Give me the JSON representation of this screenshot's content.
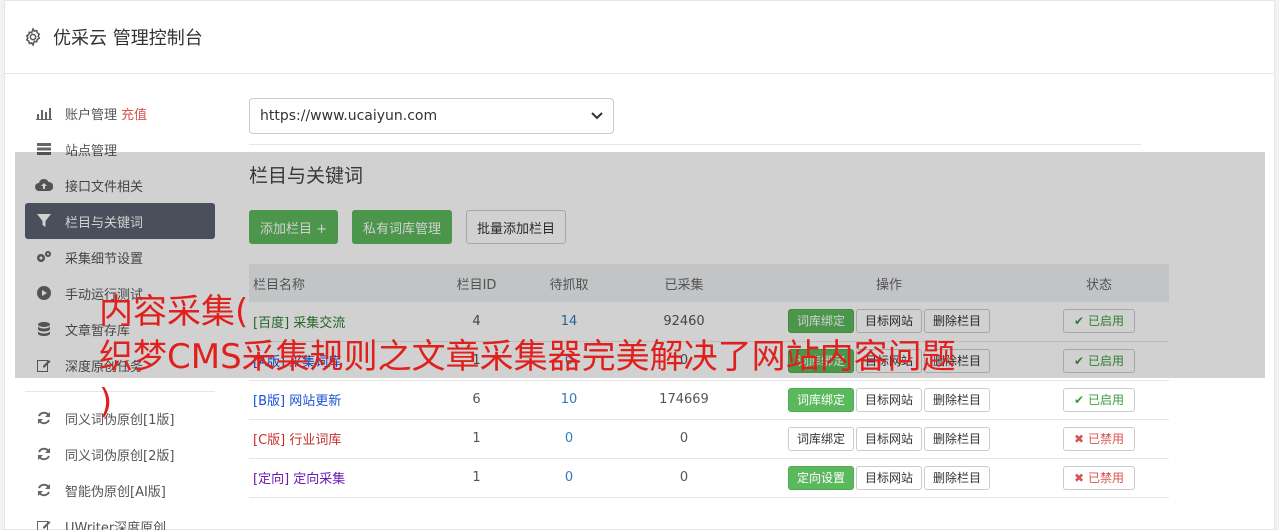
{
  "header": {
    "title": "优采云 管理控制台",
    "icon": "gear-icon"
  },
  "sidebar": {
    "items": [
      {
        "label": "账户管理",
        "extra": "充值",
        "icon": "bar-chart-icon",
        "active": false
      },
      {
        "label": "站点管理",
        "icon": "server-icon",
        "active": false
      },
      {
        "label": "接口文件相关",
        "icon": "cloud-upload-icon",
        "active": false
      },
      {
        "label": "栏目与关键词",
        "icon": "filter-icon",
        "active": true
      },
      {
        "label": "采集细节设置",
        "icon": "cogs-icon",
        "active": false
      },
      {
        "label": "手动运行测试",
        "icon": "play-circle-icon",
        "active": false
      },
      {
        "label": "文章暂存库",
        "icon": "database-icon",
        "active": false
      },
      {
        "label": "深度原创任务",
        "icon": "edit-icon",
        "active": false
      }
    ],
    "items2": [
      {
        "label": "同义词伪原创[1版]",
        "icon": "refresh-icon"
      },
      {
        "label": "同义词伪原创[2版]",
        "icon": "refresh-icon"
      },
      {
        "label": "智能伪原创[AI版]",
        "icon": "refresh-icon"
      },
      {
        "label": "UWriter深度原创",
        "icon": "edit-icon"
      }
    ]
  },
  "main": {
    "site_select": "https://www.ucaiyun.com",
    "section_title": "栏目与关键词",
    "buttons": {
      "add": "添加栏目 +",
      "private": "私有词库管理",
      "batch": "批量添加栏目"
    }
  },
  "table": {
    "headers": [
      "栏目名称",
      "栏目ID",
      "待抓取",
      "已采集",
      "操作",
      "状态"
    ],
    "rows": [
      {
        "tag": "[百度]",
        "name": "采集交流",
        "tag_color": "green",
        "id": "4",
        "pending": "14",
        "collected": "92460",
        "op1": "词库绑定",
        "op1_green": true,
        "op2": "目标网站",
        "op3": "删除栏目",
        "status": "已启用",
        "enabled": true
      },
      {
        "tag": "[A版]",
        "name": "采集词库",
        "tag_color": "blue",
        "id": "1",
        "pending": "0",
        "collected": "0",
        "op1": "词库绑定",
        "op1_green": true,
        "op2": "目标网站",
        "op3": "删除栏目",
        "status": "已启用",
        "enabled": true
      },
      {
        "tag": "[B版]",
        "name": "网站更新",
        "tag_color": "blue",
        "id": "6",
        "pending": "10",
        "collected": "174669",
        "op1": "词库绑定",
        "op1_green": true,
        "op2": "目标网站",
        "op3": "删除栏目",
        "status": "已启用",
        "enabled": true
      },
      {
        "tag": "[C版]",
        "name": "行业词库",
        "tag_color": "red",
        "id": "1",
        "pending": "0",
        "collected": "0",
        "op1": "词库绑定",
        "op1_green": false,
        "op2": "目标网站",
        "op3": "删除栏目",
        "status": "已禁用",
        "enabled": false
      },
      {
        "tag": "[定向]",
        "name": "定向采集",
        "tag_color": "purple",
        "id": "1",
        "pending": "0",
        "collected": "0",
        "op1": "定向设置",
        "op1_green": true,
        "op2": "目标网站",
        "op3": "删除栏目",
        "status": "已禁用",
        "enabled": false
      }
    ]
  },
  "caption": "内容采集(\n织梦CMS采集规则之文章采集器完美解决了网站内容问题\n)"
}
